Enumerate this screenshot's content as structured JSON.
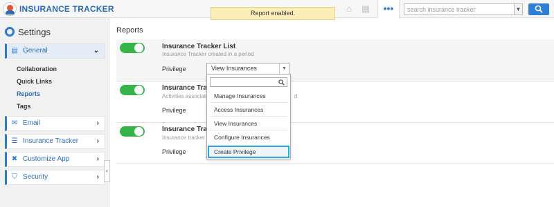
{
  "app": {
    "title": "INSURANCE TRACKER",
    "toast": "Report enabled.",
    "search_placeholder": "search insurance tracker",
    "more_icon": "•••"
  },
  "sidebar": {
    "heading": "Settings",
    "nav": [
      {
        "label": "General",
        "icon": "monitor-icon",
        "expanded": true
      },
      {
        "label": "Email",
        "icon": "envelope-icon",
        "expanded": false
      },
      {
        "label": "Insurance Tracker",
        "icon": "list-icon",
        "expanded": false
      },
      {
        "label": "Customize App",
        "icon": "tools-icon",
        "expanded": false
      },
      {
        "label": "Security",
        "icon": "lock-icon",
        "expanded": false
      }
    ],
    "subitems": [
      {
        "label": "Collaboration",
        "selected": false
      },
      {
        "label": "Quick Links",
        "selected": false
      },
      {
        "label": "Reports",
        "selected": true
      },
      {
        "label": "Tags",
        "selected": false
      }
    ]
  },
  "main": {
    "title": "Reports",
    "privilege_label": "Privilege",
    "reports": [
      {
        "name": "Insurance Tracker List",
        "desc": "Insurance Tracker created in a period",
        "enabled": true,
        "privilege": "View Insurances"
      },
      {
        "name": "Insurance Track",
        "desc": "Activities associate",
        "desc_tail": "d",
        "enabled": true
      },
      {
        "name": "Insurance Track",
        "desc": "Insurance tracker a",
        "enabled": true
      }
    ]
  },
  "dropdown": {
    "options": [
      "Manage Insurances",
      "Access Insurances",
      "View Insurances",
      "Configure Insurances"
    ],
    "create": "Create Privilege"
  },
  "colors": {
    "accent": "#2b7ad6",
    "toggle_on": "#35b44a",
    "toast": "#fbeeb8",
    "focus": "#2ba8d6"
  }
}
